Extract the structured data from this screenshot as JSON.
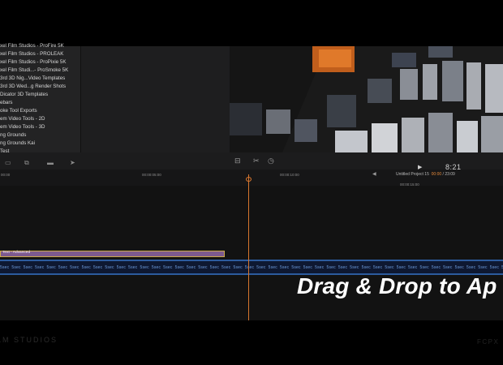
{
  "browser": {
    "items": [
      "xel Film Studios - ProFire 5K",
      "xel Film Studios - PROLEAK",
      "xel Film Studios - ProPixie 5K",
      "xel Film Studi...- ProSmoke 5K",
      "3rd 3D Nig...Video Templates",
      "3rd 3D Wed...g Render Shots",
      "Dicator 3D Templates",
      "ebars",
      "oke Tool Exports",
      "em Video Tools - 2D",
      "em Video Tools - 3D",
      "ng Grounds",
      "ng Grounds Kai",
      "Test"
    ]
  },
  "viewer": {
    "timecode": "8:21",
    "play_glyph": "▶"
  },
  "timeline": {
    "project_name": "Untitled Project 15",
    "project_time": "00:00",
    "project_duration": "/ 23:09",
    "ruler": [
      "00:00",
      "00:00:05:00",
      "00:00:10:00",
      "00:00:15:00"
    ],
    "title_clip_label": "Text - Advanced",
    "storyline_label": "5sec",
    "overlay_text": "Drag & Drop to Ap"
  },
  "branding": {
    "left_mark": "LM STUDIOS",
    "right_mark": "FCPX"
  },
  "colors": {
    "playhead": "#d7762e",
    "title_clip": "#7d5a8e",
    "storyline_border": "#2c5b9e"
  }
}
